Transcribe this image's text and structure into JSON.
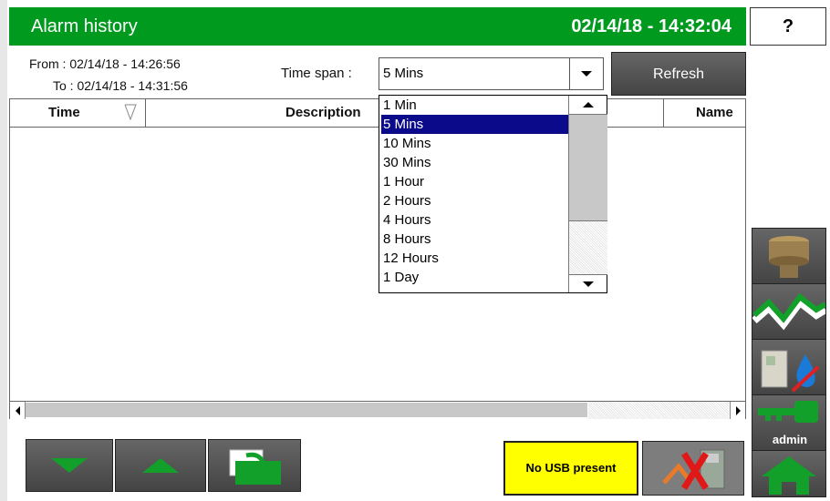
{
  "header": {
    "title": "Alarm history",
    "clock": "02/14/18 - 14:32:04",
    "help_label": "?"
  },
  "filter": {
    "from_label": "From : ",
    "from_value": "02/14/18 - 14:26:56",
    "to_label": "To : ",
    "to_value": "02/14/18 - 14:31:56",
    "time_span_label": "Time span :",
    "time_span_selected": "5 Mins",
    "refresh_label": "Refresh"
  },
  "dropdown": {
    "options": [
      "1 Min",
      "5 Mins",
      "10 Mins",
      "30 Mins",
      "1 Hour",
      "2 Hours",
      "4 Hours",
      "8 Hours",
      "12 Hours",
      "1 Day"
    ]
  },
  "table": {
    "columns": [
      "Time",
      "Description",
      "Name"
    ]
  },
  "status": {
    "usb": "No USB present"
  },
  "sidebar": {
    "user": "admin"
  },
  "colors": {
    "header_green": "#009a1f",
    "button_dark": "#555555",
    "usb_yellow": "#ffff00",
    "selection_blue": "#0a0a8a"
  }
}
